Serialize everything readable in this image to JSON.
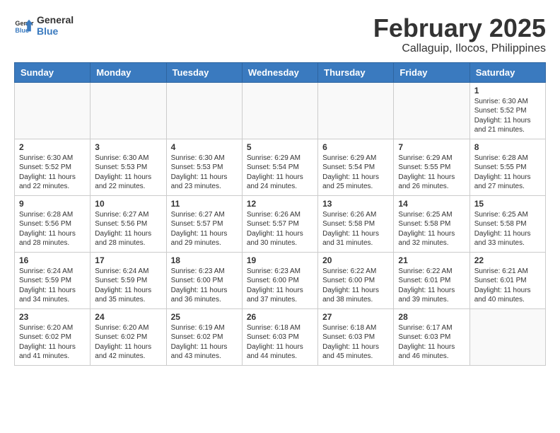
{
  "header": {
    "logo_line1": "General",
    "logo_line2": "Blue",
    "month_title": "February 2025",
    "location": "Callaguip, Ilocos, Philippines"
  },
  "days_of_week": [
    "Sunday",
    "Monday",
    "Tuesday",
    "Wednesday",
    "Thursday",
    "Friday",
    "Saturday"
  ],
  "weeks": [
    [
      {
        "day": "",
        "info": ""
      },
      {
        "day": "",
        "info": ""
      },
      {
        "day": "",
        "info": ""
      },
      {
        "day": "",
        "info": ""
      },
      {
        "day": "",
        "info": ""
      },
      {
        "day": "",
        "info": ""
      },
      {
        "day": "1",
        "info": "Sunrise: 6:30 AM\nSunset: 5:52 PM\nDaylight: 11 hours and 21 minutes."
      }
    ],
    [
      {
        "day": "2",
        "info": "Sunrise: 6:30 AM\nSunset: 5:52 PM\nDaylight: 11 hours and 22 minutes."
      },
      {
        "day": "3",
        "info": "Sunrise: 6:30 AM\nSunset: 5:53 PM\nDaylight: 11 hours and 22 minutes."
      },
      {
        "day": "4",
        "info": "Sunrise: 6:30 AM\nSunset: 5:53 PM\nDaylight: 11 hours and 23 minutes."
      },
      {
        "day": "5",
        "info": "Sunrise: 6:29 AM\nSunset: 5:54 PM\nDaylight: 11 hours and 24 minutes."
      },
      {
        "day": "6",
        "info": "Sunrise: 6:29 AM\nSunset: 5:54 PM\nDaylight: 11 hours and 25 minutes."
      },
      {
        "day": "7",
        "info": "Sunrise: 6:29 AM\nSunset: 5:55 PM\nDaylight: 11 hours and 26 minutes."
      },
      {
        "day": "8",
        "info": "Sunrise: 6:28 AM\nSunset: 5:55 PM\nDaylight: 11 hours and 27 minutes."
      }
    ],
    [
      {
        "day": "9",
        "info": "Sunrise: 6:28 AM\nSunset: 5:56 PM\nDaylight: 11 hours and 28 minutes."
      },
      {
        "day": "10",
        "info": "Sunrise: 6:27 AM\nSunset: 5:56 PM\nDaylight: 11 hours and 28 minutes."
      },
      {
        "day": "11",
        "info": "Sunrise: 6:27 AM\nSunset: 5:57 PM\nDaylight: 11 hours and 29 minutes."
      },
      {
        "day": "12",
        "info": "Sunrise: 6:26 AM\nSunset: 5:57 PM\nDaylight: 11 hours and 30 minutes."
      },
      {
        "day": "13",
        "info": "Sunrise: 6:26 AM\nSunset: 5:58 PM\nDaylight: 11 hours and 31 minutes."
      },
      {
        "day": "14",
        "info": "Sunrise: 6:25 AM\nSunset: 5:58 PM\nDaylight: 11 hours and 32 minutes."
      },
      {
        "day": "15",
        "info": "Sunrise: 6:25 AM\nSunset: 5:58 PM\nDaylight: 11 hours and 33 minutes."
      }
    ],
    [
      {
        "day": "16",
        "info": "Sunrise: 6:24 AM\nSunset: 5:59 PM\nDaylight: 11 hours and 34 minutes."
      },
      {
        "day": "17",
        "info": "Sunrise: 6:24 AM\nSunset: 5:59 PM\nDaylight: 11 hours and 35 minutes."
      },
      {
        "day": "18",
        "info": "Sunrise: 6:23 AM\nSunset: 6:00 PM\nDaylight: 11 hours and 36 minutes."
      },
      {
        "day": "19",
        "info": "Sunrise: 6:23 AM\nSunset: 6:00 PM\nDaylight: 11 hours and 37 minutes."
      },
      {
        "day": "20",
        "info": "Sunrise: 6:22 AM\nSunset: 6:00 PM\nDaylight: 11 hours and 38 minutes."
      },
      {
        "day": "21",
        "info": "Sunrise: 6:22 AM\nSunset: 6:01 PM\nDaylight: 11 hours and 39 minutes."
      },
      {
        "day": "22",
        "info": "Sunrise: 6:21 AM\nSunset: 6:01 PM\nDaylight: 11 hours and 40 minutes."
      }
    ],
    [
      {
        "day": "23",
        "info": "Sunrise: 6:20 AM\nSunset: 6:02 PM\nDaylight: 11 hours and 41 minutes."
      },
      {
        "day": "24",
        "info": "Sunrise: 6:20 AM\nSunset: 6:02 PM\nDaylight: 11 hours and 42 minutes."
      },
      {
        "day": "25",
        "info": "Sunrise: 6:19 AM\nSunset: 6:02 PM\nDaylight: 11 hours and 43 minutes."
      },
      {
        "day": "26",
        "info": "Sunrise: 6:18 AM\nSunset: 6:03 PM\nDaylight: 11 hours and 44 minutes."
      },
      {
        "day": "27",
        "info": "Sunrise: 6:18 AM\nSunset: 6:03 PM\nDaylight: 11 hours and 45 minutes."
      },
      {
        "day": "28",
        "info": "Sunrise: 6:17 AM\nSunset: 6:03 PM\nDaylight: 11 hours and 46 minutes."
      },
      {
        "day": "",
        "info": ""
      }
    ]
  ]
}
